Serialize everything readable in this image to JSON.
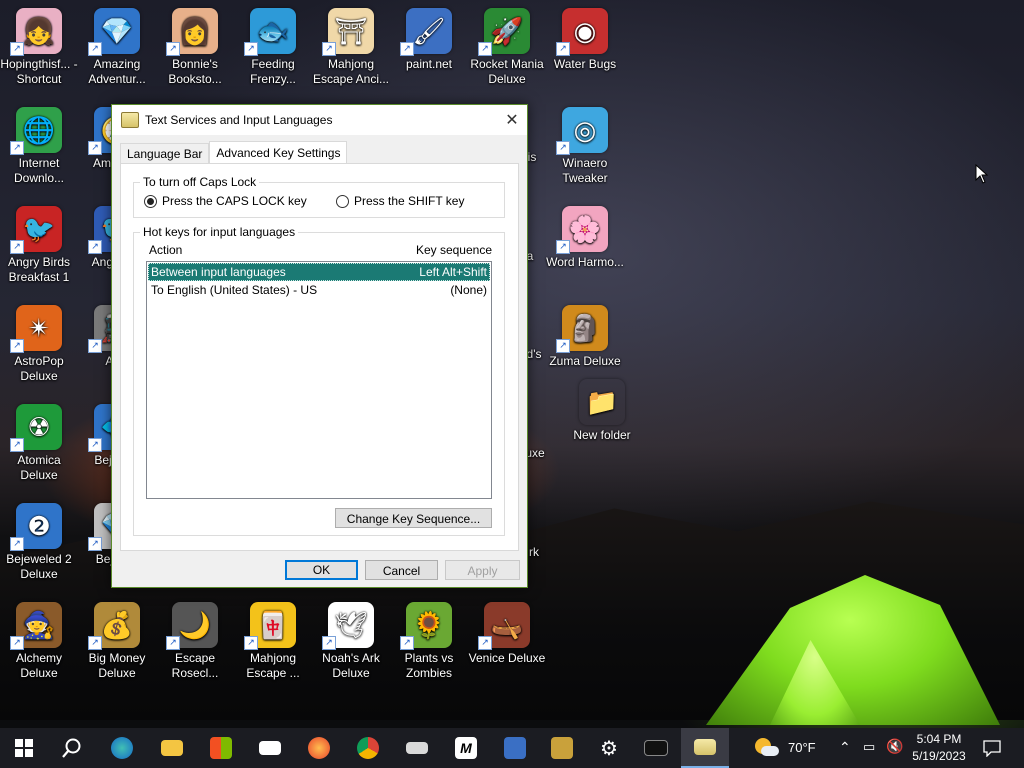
{
  "desktop": {
    "icons": [
      {
        "name": "hopingthisf-shortcut",
        "label": "Hopingthisf... - Shortcut",
        "glyph": "👧",
        "bg": "#e9b0c4"
      },
      {
        "name": "amazing-adventures",
        "label": "Amazing Adventur...",
        "glyph": "💎",
        "bg": "#2f74c9"
      },
      {
        "name": "bonnies-bookstore",
        "label": "Bonnie's Booksto...",
        "glyph": "👩",
        "bg": "#e7b08a"
      },
      {
        "name": "feeding-frenzy",
        "label": "Feeding Frenzy...",
        "glyph": "🐟",
        "bg": "#2d9ad8"
      },
      {
        "name": "mahjong-escape-ancient",
        "label": "Mahjong Escape Anci...",
        "glyph": "⛩",
        "bg": "#f0d8a8"
      },
      {
        "name": "paint-net",
        "label": "paint.net",
        "glyph": "🖌",
        "bg": "#3c6fc2"
      },
      {
        "name": "rocket-mania-deluxe",
        "label": "Rocket Mania Deluxe",
        "glyph": "🚀",
        "bg": "#2a8a34"
      },
      {
        "name": "water-bugs",
        "label": "Water Bugs",
        "glyph": "◉",
        "bg": "#c62f2f"
      },
      {
        "name": "internet-download-manager",
        "label": "Internet Downlo...",
        "glyph": "🌐",
        "bg": "#2fa04a"
      },
      {
        "name": "amazing-adventures-2",
        "label": "Am Adve",
        "glyph": "🧭",
        "bg": "#2f74c9"
      },
      {
        "name": "winaero-tweaker",
        "label": "Winaero Tweaker",
        "glyph": "◎",
        "bg": "#3ea7e0"
      },
      {
        "name": "angry-birds-breakfast",
        "label": "Angry Birds Breakfast 1",
        "glyph": "🐦",
        "bg": "#c82424"
      },
      {
        "name": "angry-birds-star",
        "label": "Angr Star",
        "glyph": "🐦",
        "bg": "#2f5bb5"
      },
      {
        "name": "word-harmony",
        "label": "Word Harmo...",
        "glyph": "🌸",
        "bg": "#f2a5c0"
      },
      {
        "name": "astropop-deluxe",
        "label": "AstroPop Deluxe",
        "glyph": "✴",
        "bg": "#e0641a"
      },
      {
        "name": "antique",
        "label": "Antil",
        "glyph": "🚂",
        "bg": "#7a7a7a"
      },
      {
        "name": "zuma-deluxe",
        "label": "Zuma Deluxe",
        "glyph": "🗿",
        "bg": "#d08a1c"
      },
      {
        "name": "new-folder",
        "label": "New folder",
        "glyph": "📁",
        "bg": "transparent"
      },
      {
        "name": "atomica-deluxe",
        "label": "Atomica Deluxe",
        "glyph": "☢",
        "bg": "#1e9a3a"
      },
      {
        "name": "bejeweled",
        "label": "Beje Del",
        "glyph": "💠",
        "bg": "#2f74c9"
      },
      {
        "name": "bejeweled-2-deluxe",
        "label": "Bejeweled 2 Deluxe",
        "glyph": "❷",
        "bg": "#2f74c9"
      },
      {
        "name": "bejeweled-twist",
        "label": "Beje Tw",
        "glyph": "💎",
        "bg": "#c0c0c0"
      },
      {
        "name": "alchemy-deluxe",
        "label": "Alchemy Deluxe",
        "glyph": "🧙",
        "bg": "#8a5a2a"
      },
      {
        "name": "big-money-deluxe",
        "label": "Big Money Deluxe",
        "glyph": "💰",
        "bg": "#b08a3a"
      },
      {
        "name": "escape-rosecliff",
        "label": "Escape Rosecl...",
        "glyph": "🌙",
        "bg": "#555555"
      },
      {
        "name": "mahjong-escape",
        "label": "Mahjong Escape ...",
        "glyph": "🀄",
        "bg": "#f3c21a"
      },
      {
        "name": "noahs-ark-deluxe",
        "label": "Noah's Ark Deluxe",
        "glyph": "🕊",
        "bg": "#ffffff"
      },
      {
        "name": "plants-vs-zombies",
        "label": "Plants vs Zombies",
        "glyph": "🌻",
        "bg": "#6aa833"
      },
      {
        "name": "venice-deluxe",
        "label": "Venice Deluxe",
        "glyph": "🛶",
        "bg": "#8a3a2a"
      }
    ],
    "partial_labels": {
      "is": "is",
      "a": "a",
      "ds": "d's",
      "uxe": "uxe",
      "rk": "rk"
    }
  },
  "dialog": {
    "title": "Text Services and Input Languages",
    "close_glyph": "✕",
    "tabs": [
      "Language Bar",
      "Advanced Key Settings"
    ],
    "active_tab": "Advanced Key Settings",
    "caps_group_title": "To turn off Caps Lock",
    "radio_caps": "Press the CAPS LOCK key",
    "radio_shift": "Press the SHIFT key",
    "selected_radio": "Press the CAPS LOCK key",
    "hotkeys_group_title": "Hot keys for input languages",
    "col_action": "Action",
    "col_key_sequence": "Key sequence",
    "rows": [
      {
        "action": "Between input languages",
        "key": "Left Alt+Shift",
        "selected": true
      },
      {
        "action": "To English (United States) - US",
        "key": "(None)",
        "selected": false
      }
    ],
    "change_key_button": "Change Key Sequence...",
    "ok_button": "OK",
    "cancel_button": "Cancel",
    "apply_button": "Apply"
  },
  "taskbar": {
    "items": [
      "windows-start",
      "search",
      "edge",
      "file-explorer",
      "microsoft-store",
      "mail",
      "firefox",
      "chrome",
      "printer-app",
      "m-app",
      "notes-app",
      "package-app",
      "settings",
      "command-prompt",
      "keyboard-app"
    ],
    "weather": "70°F",
    "time": "5:04 PM",
    "date": "5/19/2023"
  }
}
